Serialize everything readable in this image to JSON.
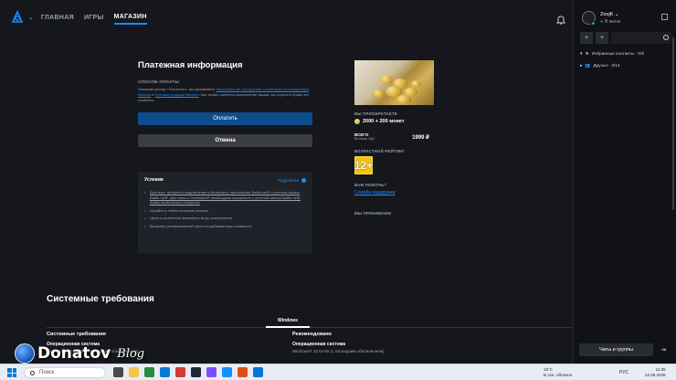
{
  "nav": {
    "items": [
      {
        "label": "ГЛАВНАЯ",
        "active": false
      },
      {
        "label": "ИГРЫ",
        "active": false
      },
      {
        "label": "МАГАЗИН",
        "active": true
      }
    ]
  },
  "payment": {
    "title": "Платежная информация",
    "method_caption": "СПОСОБ ОПЛАТЫ",
    "legal_part1": "Нажимая кнопку «Оплатить», вы принимаете ",
    "legal_link1": "Лицензионное соглашение с конечным пользователем Blizzard",
    "legal_part2": " и ",
    "legal_link2": "Условия продажи Blizzard",
    "legal_part3": ". Как только начнется выполнение заказа, вы утратите право его отменить.",
    "pay_label": "Оплатить",
    "cancel_label": "Отмена"
  },
  "terms": {
    "title": "Условия",
    "more_label": "Подробнее",
    "items": [
      "Для игры требуется подключение к Интернету, приложение Battle.net® и учетная запись Battle.net®. Для игры в Overwatch® необходимо прикрепить к учетной записи Battle.net® номер мобильного телефона.",
      "Играйте в любом игровом регионе.",
      "Цены в розничных магазинах могут различаться.",
      "Включает установленный налог на добавленную стоимость."
    ]
  },
  "summary": {
    "buying_caption": "ВЫ ПРИОБРЕТАЕТЕ",
    "product_name": "2000 + 200 монет",
    "total_label": "ВСЕГО",
    "total_sub": "Включая НДС",
    "total_value": "1999 ₽",
    "rating_caption": "ВОЗРАСТНОЙ РЕЙТИНГ",
    "rating_value": "12+",
    "help_caption": "ВАМ ПОМОЧЬ?",
    "support_link": "Служба поддержки",
    "accept_caption": "МЫ ПРИНИМАЕМ"
  },
  "sysreq": {
    "title": "Системные требования",
    "os_tab": "Windows",
    "min_header": "Системные требования",
    "rec_header": "Рекомендовано",
    "os_label": "Операционная система",
    "min_os_value": "Windows® 10 64-bit (с последним обновлением)",
    "rec_os_value": "Windows® 10 64-bit (с последним обновлением)"
  },
  "social": {
    "username": "ZoojK",
    "status": "В меню",
    "groups": [
      {
        "label": "Избранные контакты - 0/0"
      },
      {
        "label": "Друзья - 3/14"
      }
    ],
    "chat_label": "Чаты и группы"
  },
  "taskbar": {
    "search_placeholder": "Поиск",
    "weather_temp": "19°C",
    "weather_desc": "В осн. облачно",
    "lang": "РУС",
    "time": "11:39",
    "date": "22.06.2026"
  },
  "watermark": {
    "brand": "Donatov",
    "suffix": "Blog"
  }
}
